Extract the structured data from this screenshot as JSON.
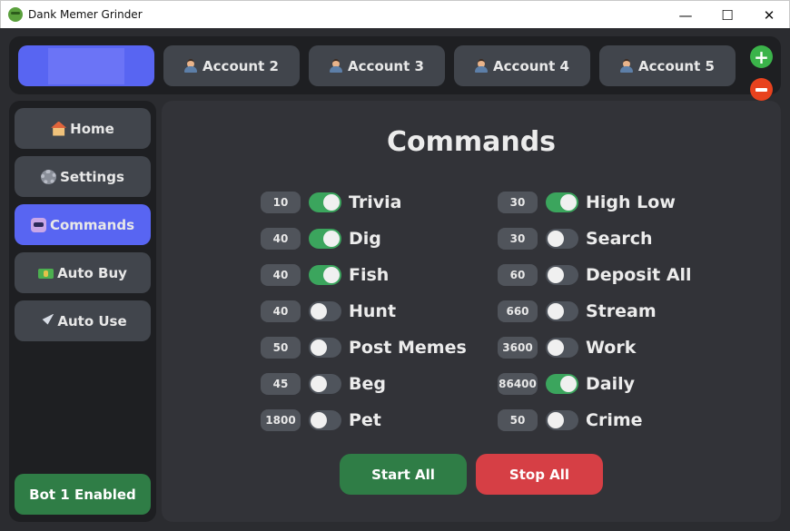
{
  "window": {
    "title": "Dank Memer Grinder",
    "controls": {
      "minimize": "—",
      "maximize": "☐",
      "close": "✕"
    }
  },
  "accounts": {
    "items": [
      {
        "label": "",
        "active": true
      },
      {
        "label": "Account 2"
      },
      {
        "label": "Account 3"
      },
      {
        "label": "Account 4"
      },
      {
        "label": "Account 5"
      }
    ],
    "add_label": "+",
    "remove_label": "−"
  },
  "sidebar": {
    "items": [
      {
        "label": "Home",
        "icon": "house-icon"
      },
      {
        "label": "Settings",
        "icon": "gear-icon"
      },
      {
        "label": "Commands",
        "icon": "robot-icon",
        "active": true
      },
      {
        "label": "Auto Buy",
        "icon": "money-icon"
      },
      {
        "label": "Auto Use",
        "icon": "rocket-icon"
      }
    ],
    "status": "Bot 1 Enabled"
  },
  "commands": {
    "title": "Commands",
    "left": [
      {
        "delay": "10",
        "enabled": true,
        "name": "Trivia"
      },
      {
        "delay": "40",
        "enabled": true,
        "name": "Dig"
      },
      {
        "delay": "40",
        "enabled": true,
        "name": "Fish"
      },
      {
        "delay": "40",
        "enabled": false,
        "name": "Hunt"
      },
      {
        "delay": "50",
        "enabled": false,
        "name": "Post Memes"
      },
      {
        "delay": "45",
        "enabled": false,
        "name": "Beg"
      },
      {
        "delay": "1800",
        "enabled": false,
        "name": "Pet"
      }
    ],
    "right": [
      {
        "delay": "30",
        "enabled": true,
        "name": "High Low"
      },
      {
        "delay": "30",
        "enabled": false,
        "name": "Search"
      },
      {
        "delay": "60",
        "enabled": false,
        "name": "Deposit All"
      },
      {
        "delay": "660",
        "enabled": false,
        "name": "Stream"
      },
      {
        "delay": "3600",
        "enabled": false,
        "name": "Work"
      },
      {
        "delay": "86400",
        "enabled": true,
        "name": "Daily"
      },
      {
        "delay": "50",
        "enabled": false,
        "name": "Crime"
      }
    ],
    "start_label": "Start All",
    "stop_label": "Stop All"
  },
  "colors": {
    "accent": "#5865f2",
    "toggle_on": "#3ba55d",
    "start": "#2f7d46",
    "stop": "#d63f45"
  }
}
